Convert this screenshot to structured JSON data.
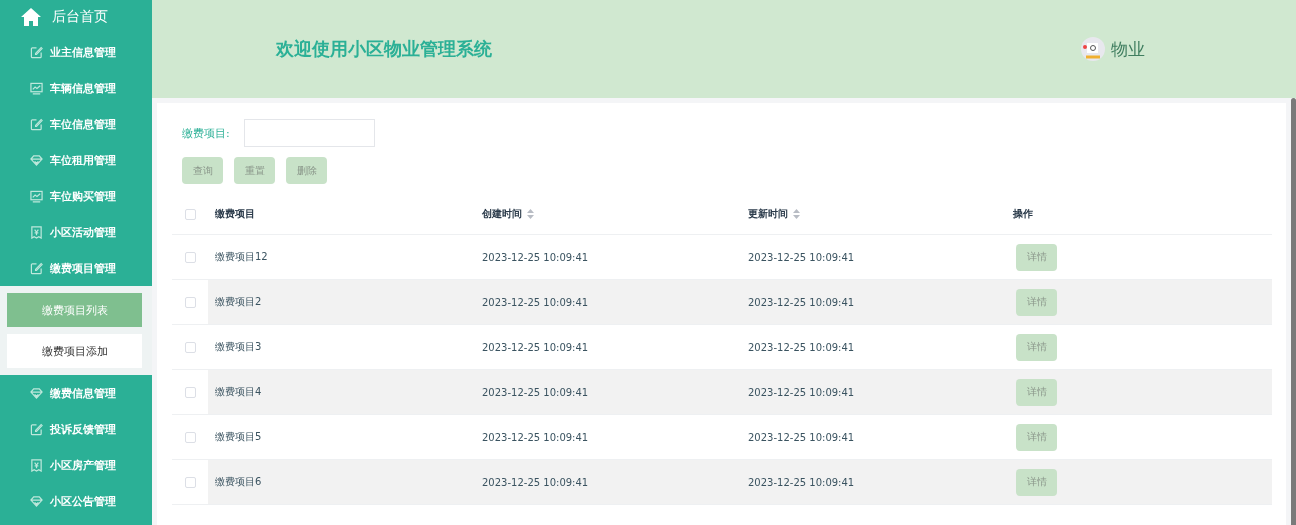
{
  "sidebar": {
    "home": "后台首页",
    "items": [
      {
        "label": "业主信息管理",
        "kind": "edit"
      },
      {
        "label": "车辆信息管理",
        "kind": "monitor"
      },
      {
        "label": "车位信息管理",
        "kind": "edit"
      },
      {
        "label": "车位租用管理",
        "kind": "gem"
      },
      {
        "label": "车位购买管理",
        "kind": "monitor"
      },
      {
        "label": "小区活动管理",
        "kind": "receipt"
      },
      {
        "label": "缴费项目管理",
        "kind": "edit",
        "children": [
          {
            "label": "缴费项目列表",
            "selected": true
          },
          {
            "label": "缴费项目添加",
            "selected": false
          }
        ]
      },
      {
        "label": "缴费信息管理",
        "kind": "gem"
      },
      {
        "label": "投诉反馈管理",
        "kind": "edit"
      },
      {
        "label": "小区房产管理",
        "kind": "receipt"
      },
      {
        "label": "小区公告管理",
        "kind": "gem"
      }
    ]
  },
  "header": {
    "title": "欢迎使用小区物业管理系统",
    "user": "物业"
  },
  "search": {
    "label": "缴费项目:",
    "buttons": [
      "查询",
      "重置",
      "删除"
    ]
  },
  "table": {
    "all_checked": false,
    "columns": [
      {
        "label": "缴费项目",
        "sortable": false
      },
      {
        "label": "创建时间",
        "sortable": true
      },
      {
        "label": "更新时间",
        "sortable": true
      },
      {
        "label": "操作",
        "sortable": false
      }
    ],
    "rows": [
      {
        "checked": false,
        "name": "缴费项目12",
        "created": "2023-12-25 10:09:41",
        "updated": "2023-12-25 10:09:41",
        "action": "详情"
      },
      {
        "checked": false,
        "name": "缴费项目2",
        "created": "2023-12-25 10:09:41",
        "updated": "2023-12-25 10:09:41",
        "action": "详情"
      },
      {
        "checked": false,
        "name": "缴费项目3",
        "created": "2023-12-25 10:09:41",
        "updated": "2023-12-25 10:09:41",
        "action": "详情"
      },
      {
        "checked": false,
        "name": "缴费项目4",
        "created": "2023-12-25 10:09:41",
        "updated": "2023-12-25 10:09:41",
        "action": "详情"
      },
      {
        "checked": false,
        "name": "缴费项目5",
        "created": "2023-12-25 10:09:41",
        "updated": "2023-12-25 10:09:41",
        "action": "详情"
      },
      {
        "checked": false,
        "name": "缴费项目6",
        "created": "2023-12-25 10:09:41",
        "updated": "2023-12-25 10:09:41",
        "action": "详情"
      }
    ]
  }
}
